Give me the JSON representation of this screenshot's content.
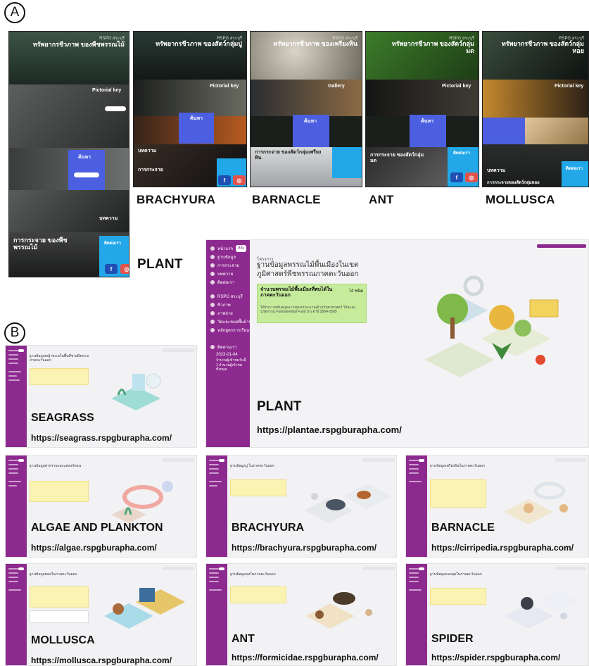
{
  "panels": {
    "a": "A",
    "b": "B"
  },
  "panel_a": {
    "phones": [
      {
        "id": "plant",
        "caption": "PLANT",
        "hero_sub": "RSPG สระบุรี",
        "hero_title": "ทรัพยากรชีวภาพ ของพืชพรรณไม้",
        "tiles": [
          "Pictorial key",
          "ค้นหา",
          "บทความ",
          "การกระจาย ของพืชพรรณไม้",
          "ติดต่อเรา"
        ],
        "social": [
          "f",
          "◎"
        ]
      },
      {
        "id": "brachyura",
        "caption": "BRACHYURA",
        "hero_sub": "RSPG สระบุรี",
        "hero_title": "ทรัพยากรชีวภาพ ของสัตว์กลุ่มปู",
        "tiles": [
          "Pictorial key",
          "ค้นหา",
          "บทความ",
          "การกระจาย"
        ],
        "social": [
          "f",
          "◎"
        ]
      },
      {
        "id": "barnacle",
        "caption": "BARNACLE",
        "hero_sub": "RSPG สระบุรี",
        "hero_title": "ทรัพยากรชีวภาพ ของเพรียงหิน",
        "tiles": [
          "Gallery",
          "ค้นหา",
          "การกระจาย ของสัตว์กลุ่มเพรียงหิน"
        ],
        "social": []
      },
      {
        "id": "ant",
        "caption": "ANT",
        "hero_sub": "RSPG สระบุรี",
        "hero_title": "ทรัพยากรชีวภาพ ของสัตว์กลุ่มมด",
        "tiles": [
          "Pictorial key",
          "ค้นหา",
          "การกระจาย ของสัตว์กลุ่มมด",
          "ติดต่อเรา"
        ],
        "social": [
          "f",
          "◎"
        ]
      },
      {
        "id": "mollusca",
        "caption": "MOLLUSCA",
        "hero_sub": "RSPG สระบุรี",
        "hero_title": "ทรัพยากรชีวภาพ ของสัตว์กลุ่มหอย",
        "tiles": [
          "Pictorial key",
          "บทความ",
          "ติดต่อเรา",
          "การกระจายของสัตว์กลุ่มหอย"
        ],
        "social": []
      }
    ]
  },
  "panel_b": {
    "big": {
      "name": "PLANT",
      "url": "https://plantae.rspgburapha.com/",
      "menu": [
        "หน้าแรก",
        "ฐานข้อมูล",
        "การกระจาย",
        "บทความ",
        "ติดต่อเรา",
        "RSPG สระบุรี",
        "ชีวภาพ",
        "ภาพถ่าย",
        "วัดและหมอพื้นบ้าน",
        "หลักสูตรการเรียนรู้",
        "ติดตามเรา"
      ],
      "kicker": "โครงการ",
      "title": "ฐานข้อมูลพรรณไม้พื้นเมืองในเขต ภูมิศาสตร์พืชพรรณภาคตะวันออก",
      "box_title": "จำนวนพรรณไม้พื้นเมืองที่พบได้ใน ภาคตะวันออก",
      "box_value": "74 ชนิด",
      "box_note": "ได้รับการสนับสนุนจากทุนงบประมาณด้านวิทยาศาสตร์ วิจัยและนวัตกรรม Fundamental Fund ประจำปี 2564-2565",
      "side_date": "2023-01-04",
      "side_note": "จำนวนผู้เข้าชมวันนี้ 1 จำนวนผู้เข้าชมทั้งหมด"
    },
    "sites": [
      {
        "name": "SEAGRASS",
        "url": "https://seagrass.rspgburapha.com/",
        "title": "ฐานข้อมูลหญ้าทะเลในพื้นที่ชายฝั่งทะเลภาคตะวันออก"
      },
      {
        "name": "ALGAE AND PLANKTON",
        "url": "https://algae.rspgburapha.com/",
        "title": "ฐานข้อมูลสาหร่ายและแพลงก์ตอน"
      },
      {
        "name": "BRACHYURA",
        "url": "https://brachyura.rspgburapha.com/",
        "title": "ฐานข้อมูลปู ในภาคตะวันออก"
      },
      {
        "name": "BARNACLE",
        "url": "https://cirripedia.rspgburapha.com/",
        "title": "ฐานข้อมูลเพรียงหินในภาคตะวันออก"
      },
      {
        "name": "MOLLUSCA",
        "url": "https://mollusca.rspgburapha.com/",
        "title": "ฐานข้อมูลหอยในภาคตะวันออก"
      },
      {
        "name": "ANT",
        "url": "https://formicidae.rspgburapha.com/",
        "title": "ฐานข้อมูลมดในภาคตะวันออก"
      },
      {
        "name": "SPIDER",
        "url": "https://spider.rspgburapha.com/",
        "title": "ฐานข้อมูลแมงมุมในภาคตะวันออก"
      }
    ]
  },
  "colors": {
    "sidebar": "#8d2a8f",
    "search": "#4c5fe0",
    "contact": "#22a8e8",
    "infobox_yellow": "#fbf3b2",
    "infobox_green": "#c6ec9b"
  }
}
